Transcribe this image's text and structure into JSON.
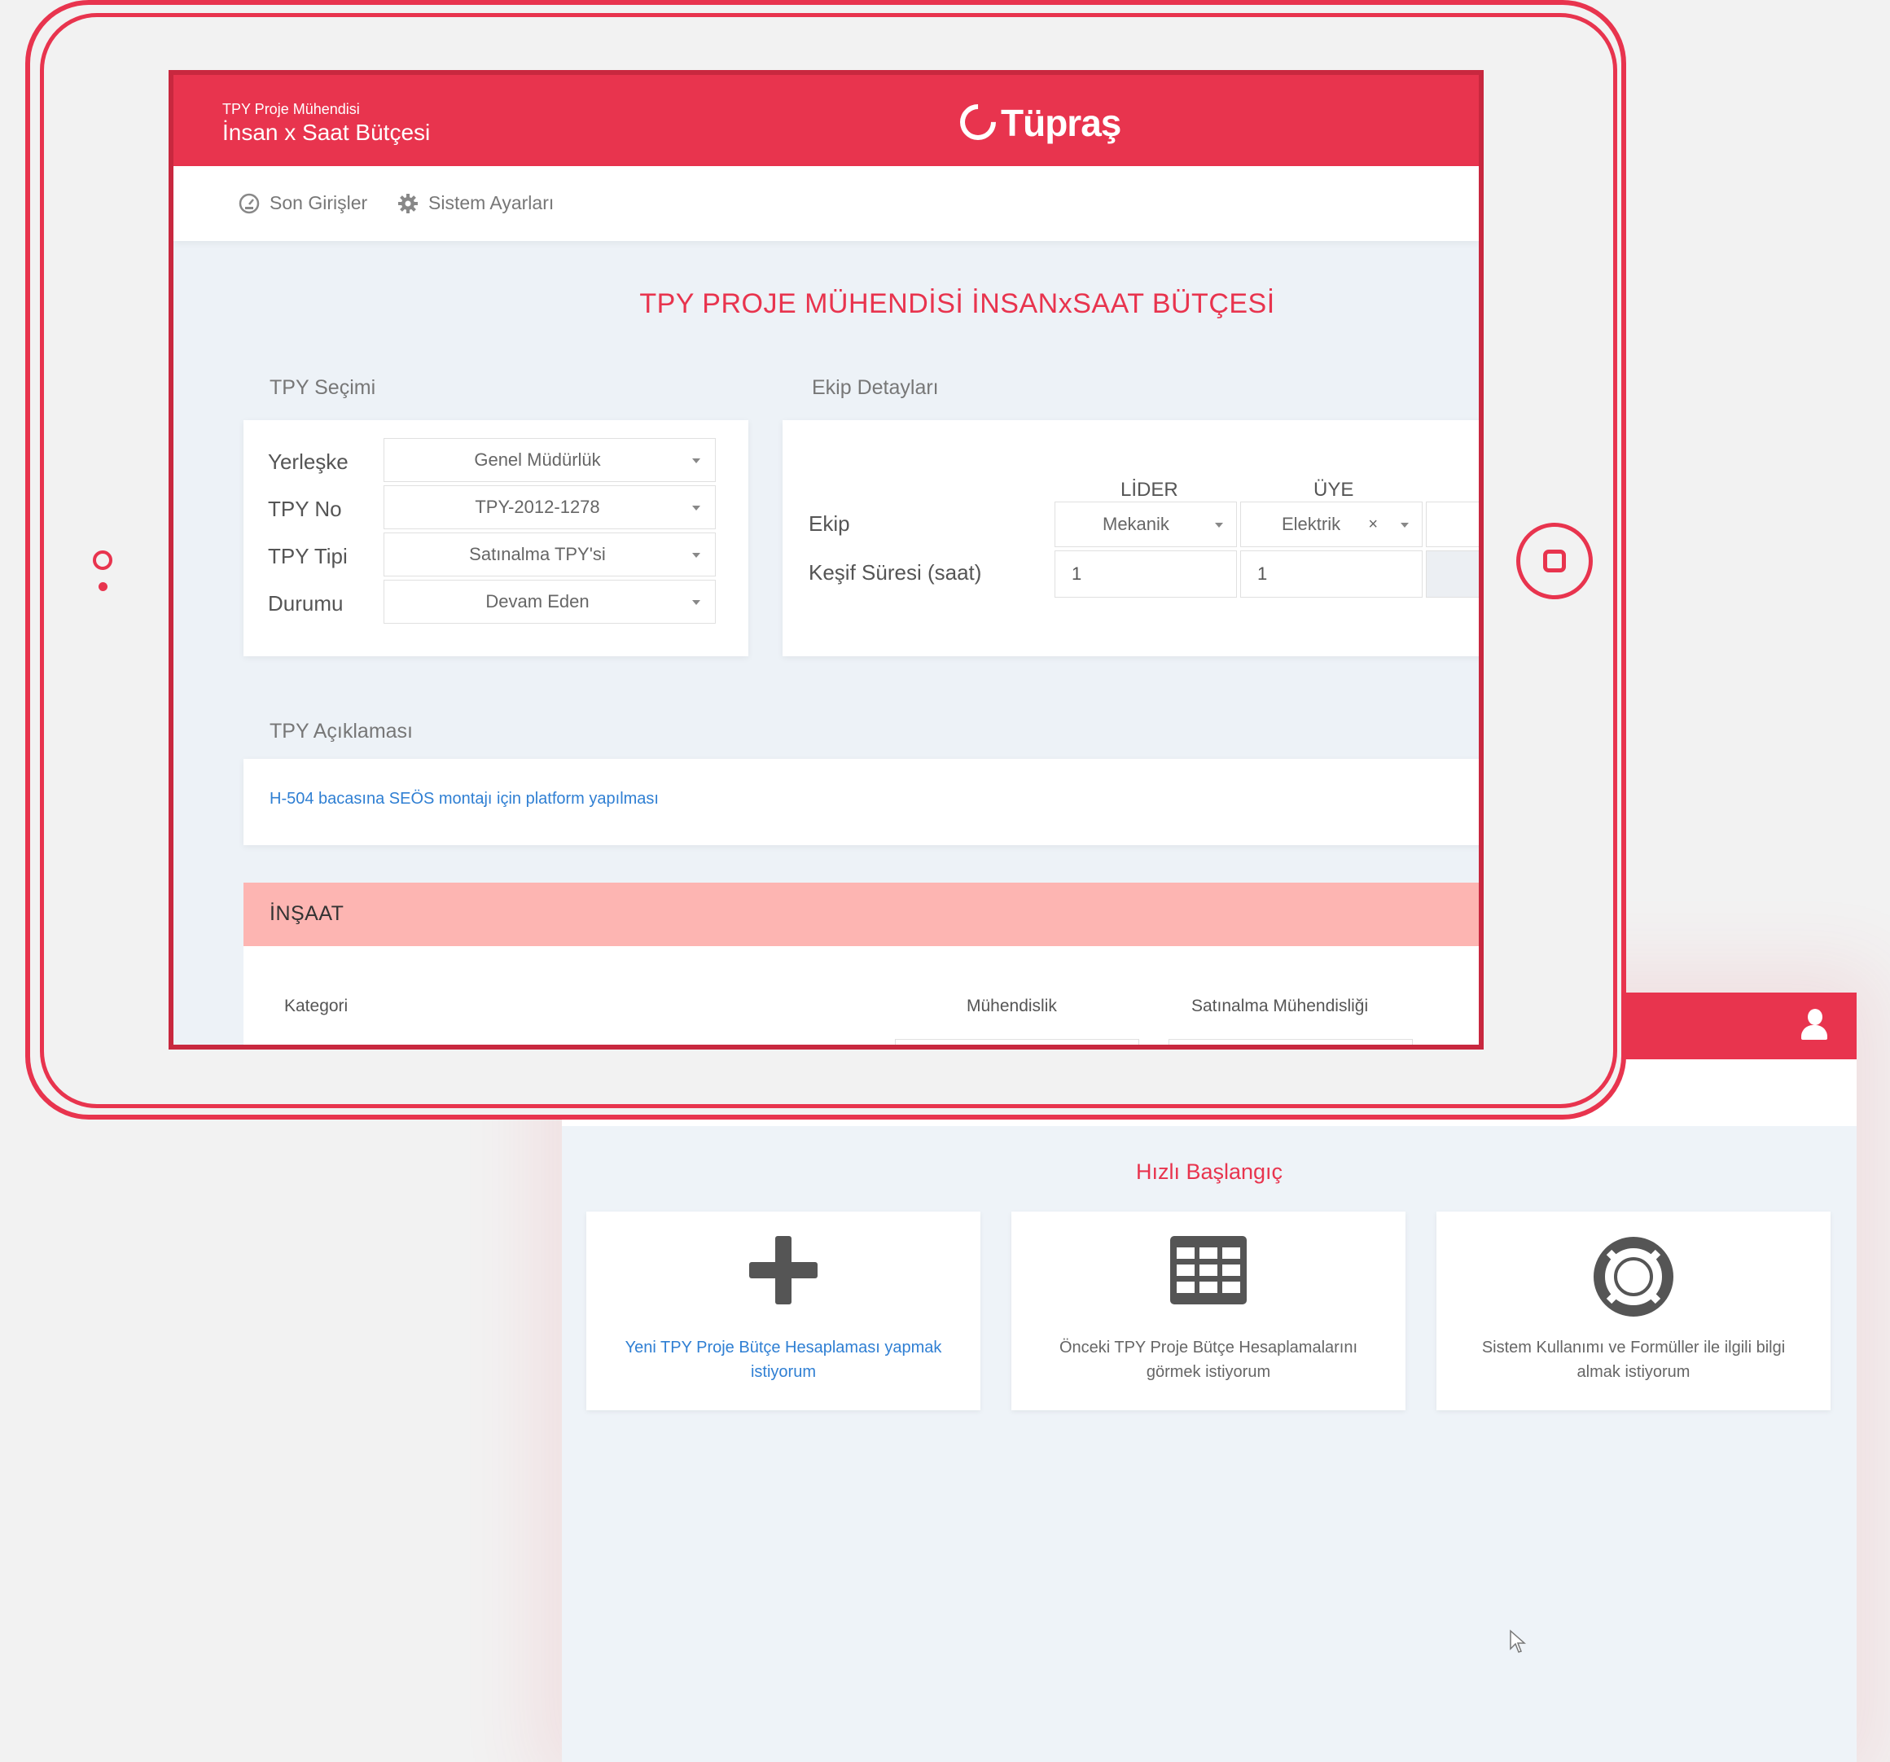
{
  "back_window": {
    "quick_start_title": "Hızlı Başlangıç",
    "cards": [
      {
        "icon": "plus-icon",
        "text": "Yeni TPY Proje Bütçe Hesaplaması yapmak istiyorum"
      },
      {
        "icon": "grid-table-icon",
        "text": "Önceki TPY Proje Bütçe Hesaplamalarını görmek istiyorum"
      },
      {
        "icon": "lifebuoy-icon",
        "text": "Sistem Kullanımı ve Formüller ile ilgili bilgi almak istiyorum"
      }
    ]
  },
  "app": {
    "header": {
      "subtitle": "TPY Proje Mühendisi",
      "title": "İnsan x Saat Bütçesi",
      "brand": "Tüpraş"
    },
    "nav": [
      {
        "icon": "speedometer-icon",
        "label": "Son Girişler"
      },
      {
        "icon": "gear-icon",
        "label": "Sistem Ayarları"
      }
    ],
    "page_title": "TPY PROJE MÜHENDİSİ İNSANxSAAT BÜTÇESİ",
    "tpy_selection": {
      "heading": "TPY Seçimi",
      "fields": [
        {
          "label": "Yerleşke",
          "value": "Genel Müdürlük"
        },
        {
          "label": "TPY No",
          "value": "TPY-2012-1278"
        },
        {
          "label": "TPY Tipi",
          "value": "Satınalma TPY'si"
        },
        {
          "label": "Durumu",
          "value": "Devam Eden"
        }
      ]
    },
    "team_details": {
      "heading": "Ekip Detayları",
      "col_leader": "LİDER",
      "col_member": "ÜYE",
      "row_team_label": "Ekip",
      "row_survey_label": "Keşif Süresi (saat)",
      "leader_value": "Mekanik",
      "member_value": "Elektrik",
      "leader_hours": "1",
      "member_hours": "1"
    },
    "description": {
      "heading": "TPY Açıklaması",
      "text": "H-504 bacasına SEÖS montajı için platform yapılması"
    },
    "insaat": {
      "title": "İNŞAAT",
      "columns": [
        "Kategori",
        "Mühendislik",
        "Satınalma Mühendisliği"
      ]
    }
  },
  "colors": {
    "brand_red": "#e8344e",
    "section_pink": "#fdb5b2",
    "link_blue": "#2f7fd3"
  }
}
